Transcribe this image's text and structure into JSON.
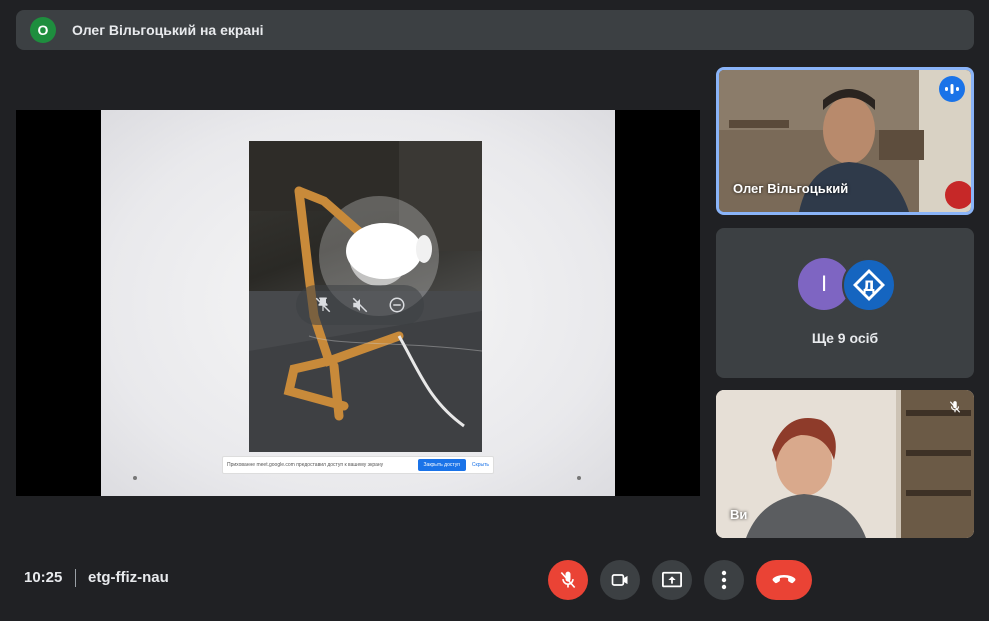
{
  "banner": {
    "avatar_letter": "О",
    "text": "Олег Вільгоцький на екрані"
  },
  "presentation": {
    "share_bar": {
      "text": "Прихованне meet.google.com предоставил доступ к вашему экрану",
      "stop_label": "Закрыть доступ",
      "hide_label": "Скрыть"
    }
  },
  "participants": {
    "speaker": {
      "name": "Олег Вільгоцький"
    },
    "more": {
      "avatar_letter": "І",
      "label": "Ще 9 осіб"
    },
    "self": {
      "name": "Ви"
    }
  },
  "bottom": {
    "time": "10:25",
    "meeting_code": "etg-ffiz-nau"
  },
  "colors": {
    "background": "#202124",
    "surface": "#3c4043",
    "accent": "#8ab4f8",
    "danger": "#ea4335"
  }
}
